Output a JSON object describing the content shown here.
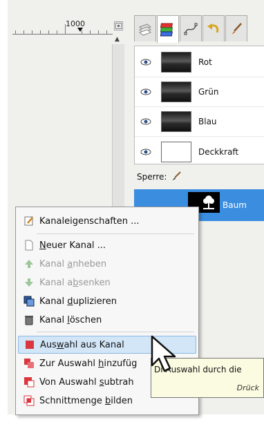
{
  "ruler": {
    "label": "1000",
    "button_icon": "navigate-icon"
  },
  "dock_tabs": [
    {
      "name": "layers",
      "icon": "layers-icon"
    },
    {
      "name": "channels",
      "icon": "channels-icon",
      "active": true
    },
    {
      "name": "paths",
      "icon": "paths-icon"
    },
    {
      "name": "undo",
      "icon": "undo-icon"
    },
    {
      "name": "brushes",
      "icon": "brush-icon"
    }
  ],
  "channels": [
    {
      "label": "Rot"
    },
    {
      "label": "Grün"
    },
    {
      "label": "Blau"
    },
    {
      "label": "Deckkraft"
    }
  ],
  "lock": {
    "label": "Sperre:"
  },
  "selected_channel": {
    "label": "Baum"
  },
  "menu": {
    "items": [
      {
        "pre": "Kanaleigenschaften ...",
        "u": "",
        "post": "",
        "icon": "edit-icon",
        "disabled": false
      },
      {
        "pre": "",
        "u": "N",
        "post": "euer Kanal ...",
        "icon": "new-page-icon",
        "disabled": false
      },
      {
        "pre": "Kanal ",
        "u": "a",
        "post": "nheben",
        "icon": "arrow-up-icon",
        "disabled": true
      },
      {
        "pre": "Kanal a",
        "u": "b",
        "post": "senken",
        "icon": "arrow-down-icon",
        "disabled": true
      },
      {
        "pre": "Kanal ",
        "u": "d",
        "post": "uplizieren",
        "icon": "duplicate-icon",
        "disabled": false
      },
      {
        "pre": "Kanal ",
        "u": "l",
        "post": "öschen",
        "icon": "trash-icon",
        "disabled": false
      },
      {
        "pre": "Aus",
        "u": "w",
        "post": "ahl aus Kanal",
        "icon": "selection-icon",
        "disabled": false,
        "highlight": true
      },
      {
        "pre": "Zur Auswahl ",
        "u": "h",
        "post": "inzufüg",
        "icon": "selection-add-icon",
        "disabled": false
      },
      {
        "pre": "Von Auswahl ",
        "u": "s",
        "post": "ubtrah",
        "icon": "selection-subtract-icon",
        "disabled": false
      },
      {
        "pre": "Schnittmenge ",
        "u": "b",
        "post": "ilden",
        "icon": "selection-intersect-icon",
        "disabled": false
      }
    ]
  },
  "tooltip": {
    "line1": "Di Auswahl durch die",
    "line2": "Drück"
  },
  "colors": {
    "accent": "#3b8de0",
    "menu_highlight": "#d2e6f7",
    "tooltip_bg": "#fbfbe2"
  }
}
